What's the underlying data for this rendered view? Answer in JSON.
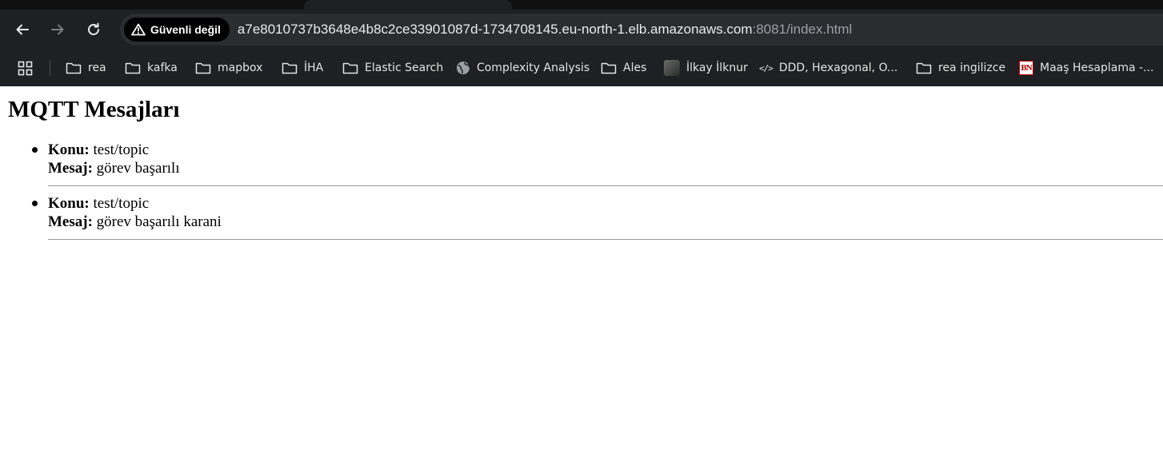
{
  "browser": {
    "security_chip": "Güvenli değil",
    "url_host": "a7e8010737b3648e4b8c2ce33901087d-1734708145.eu-north-1.elb.amazonaws.com",
    "url_port_path": ":8081/index.html",
    "bookmarks": [
      {
        "label": "rea",
        "icon": "folder-icon"
      },
      {
        "label": "kafka",
        "icon": "folder-icon"
      },
      {
        "label": "mapbox",
        "icon": "folder-icon"
      },
      {
        "label": "İHA",
        "icon": "folder-icon"
      },
      {
        "label": "Elastic Search",
        "icon": "folder-icon"
      },
      {
        "label": "Complexity Analysis",
        "icon": "globe-icon"
      },
      {
        "label": "Ales",
        "icon": "folder-icon"
      },
      {
        "label": "İlkay İlknur",
        "icon": "photo-favicon"
      },
      {
        "label": "DDD, Hexagonal, O...",
        "icon": "code-icon"
      },
      {
        "label": "rea ingilizce",
        "icon": "folder-icon"
      },
      {
        "label": "Maaş Hesaplama -...",
        "icon": "bn-favicon"
      }
    ],
    "bn_icon_text": "BN"
  },
  "page": {
    "title": "MQTT Mesajları",
    "topic_label": "Konu:",
    "message_label": "Mesaj:",
    "messages": [
      {
        "topic": "test/topic",
        "message": "görev başarılı"
      },
      {
        "topic": "test/topic",
        "message": "görev başarılı karani"
      }
    ]
  },
  "colors": {
    "chrome_bg": "#1f2023",
    "omnibox_bg": "#2b2c30",
    "chip_bg": "#000000",
    "divider": "#999999"
  }
}
